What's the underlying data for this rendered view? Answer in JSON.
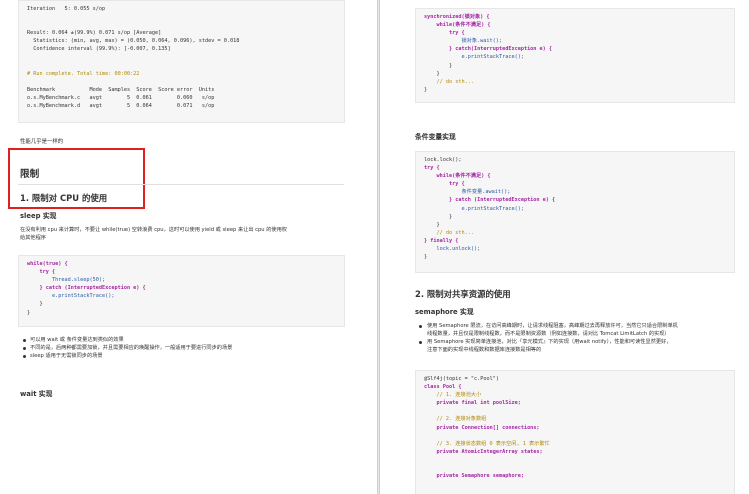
{
  "left": {
    "output_lines": [
      "Iteration   5: 0.055 s/op",
      "",
      "",
      "Result: 0.064 ±(99.9%) 0.071 s/op [Average]",
      "  Statistics: (min, avg, max) = (0.050, 0.064, 0.096), stdev = 0.018",
      "  Confidence interval (99.9%): [-0.007, 0.135]",
      "",
      "",
      "# Run complete. Total time: 00:00:22",
      "",
      "Benchmark           Mode  Samples  Score  Score error  Units",
      "o.s.MyBenchmark.c   avgt        5  0.061        0.060   s/op",
      "o.s.MyBenchmark.d   avgt        5  0.064        0.071   s/op"
    ],
    "note": "性能几乎是一样的",
    "heading_limit": "限制",
    "heading_cpu": "1. 限制对 CPU 的使用",
    "heading_sleep": "sleep 实现",
    "sleep_para": [
      "在没有利用 cpu 来计算时，不要让 while(true) 空转浪费 cpu，这时可以使用 yield 或 sleep 来让出 cpu 的使用权",
      "给其他程序"
    ],
    "sleep_code": [
      "while(true) {",
      "    try {",
      "        Thread.sleep(50);",
      "    } catch (InterruptedException e) {",
      "        e.printStackTrace();",
      "    }",
      "}"
    ],
    "bullets": [
      "可以用 wait 或 条件变量达到类似的效果",
      "不同的是，后两种都需要加锁，并且需要相应的唤醒操作，一般适用于要进行同步的场景",
      "sleep 适用于无需锁同步的场景"
    ],
    "heading_wait": "wait 实现"
  },
  "right": {
    "wait_code": [
      "synchronized(锁对象) {",
      "    while(条件不满足) {",
      "        try {",
      "            锁对象.wait();",
      "        } catch(InterruptedException e) {",
      "            e.printStackTrace();",
      "        }",
      "    }",
      "    // do sth...",
      "}"
    ],
    "heading_cond": "条件变量实现",
    "cond_code": [
      "lock.lock();",
      "try {",
      "    while(条件不满足) {",
      "        try {",
      "            条件变量.await();",
      "        } catch (InterruptedException e) {",
      "            e.printStackTrace();",
      "        }",
      "    }",
      "    // do sth...",
      "} finally {",
      "    lock.unlock();",
      "}"
    ],
    "heading_shared": "2. 限制对共享资源的使用",
    "heading_semaphore": "semaphore 实现",
    "sem_bullets": [
      "使用 Semaphore 限流，在访问高峰期时，让请求线程阻塞，高峰期过去再释放许可，当然它只适合限制单机",
      "线程数量，并且仅是限制线程数，而不是限制资源数（例如连接数，请对比 Tomcat LimitLatch 的实现）",
      "用 Semaphore 实现简单连接池，对比『享元模式』下的实现（用wait notify），性能和可读性显然更好，",
      "注意下面的实现中线程数和数据库连接数是相等的"
    ],
    "pool_code": [
      "@Slf4j(topic = \"c.Pool\")",
      "class Pool {",
      "    // 1. 连接池大小",
      "    private final int poolSize;",
      "",
      "    // 2. 连接对象数组",
      "    private Connection[] connections;",
      "",
      "    // 3. 连接状态数组 0 表示空闲, 1 表示繁忙",
      "    private AtomicIntegerArray states;",
      "",
      "",
      "    private Semaphore semaphore;"
    ]
  }
}
